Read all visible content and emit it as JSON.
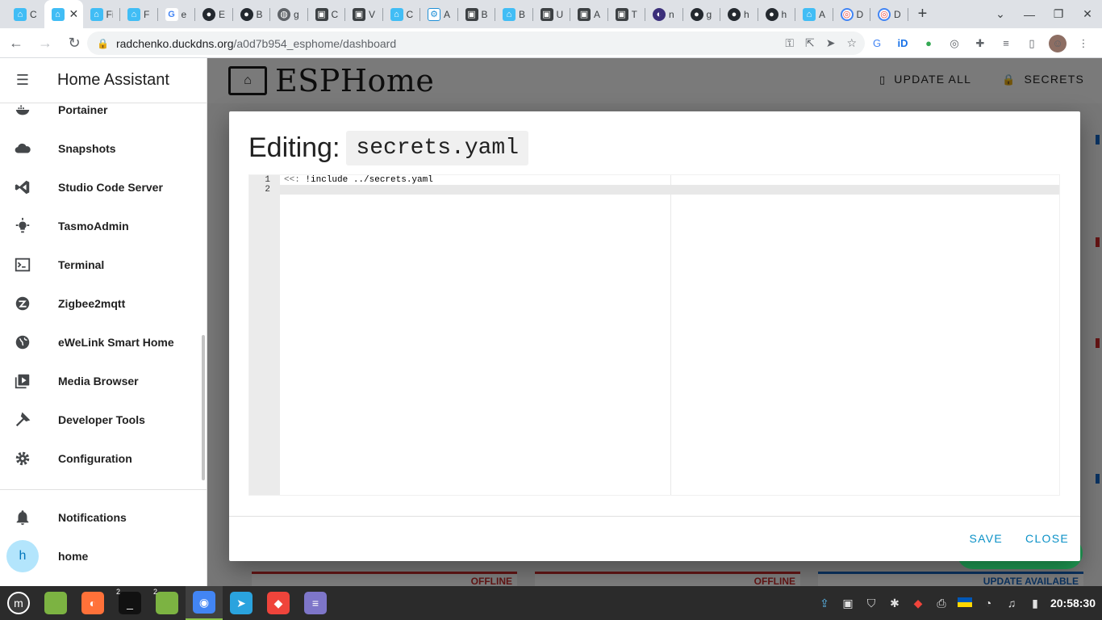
{
  "browser": {
    "tabs": [
      {
        "icon": "ha",
        "label": "C"
      },
      {
        "icon": "ha",
        "label": "",
        "active": true
      },
      {
        "icon": "ha",
        "label": "Fi"
      },
      {
        "icon": "ha",
        "label": "Fi"
      },
      {
        "icon": "g",
        "label": "e"
      },
      {
        "icon": "gh",
        "label": "E"
      },
      {
        "icon": "gh",
        "label": "B"
      },
      {
        "icon": "gl",
        "label": "g"
      },
      {
        "icon": "ro",
        "label": "C"
      },
      {
        "icon": "ro",
        "label": "V"
      },
      {
        "icon": "ha",
        "label": "C"
      },
      {
        "icon": "esp",
        "label": "A"
      },
      {
        "icon": "ro",
        "label": "B"
      },
      {
        "icon": "ha",
        "label": "B"
      },
      {
        "icon": "ro",
        "label": "U"
      },
      {
        "icon": "ro",
        "label": "A"
      },
      {
        "icon": "ro",
        "label": "T"
      },
      {
        "icon": "nr",
        "label": "n"
      },
      {
        "icon": "gh",
        "label": "g"
      },
      {
        "icon": "gh",
        "label": "h"
      },
      {
        "icon": "gh",
        "label": "h"
      },
      {
        "icon": "ha",
        "label": "A"
      },
      {
        "icon": "ch",
        "label": "D"
      },
      {
        "icon": "ch",
        "label": "D"
      }
    ],
    "new_tab": "+",
    "url_host": "radchenko.duckdns.org",
    "url_path": "/a0d7b954_esphome/dashboard"
  },
  "sidebar": {
    "title": "Home Assistant",
    "items": [
      {
        "icon": "docker-icon",
        "label": "Portainer"
      },
      {
        "icon": "cloud-icon",
        "label": "Snapshots"
      },
      {
        "icon": "vscode-icon",
        "label": "Studio Code Server"
      },
      {
        "icon": "bulb-icon",
        "label": "TasmoAdmin"
      },
      {
        "icon": "terminal-icon",
        "label": "Terminal"
      },
      {
        "icon": "zigbee-icon",
        "label": "Zigbee2mqtt"
      },
      {
        "icon": "globe-icon",
        "label": "eWeLink Smart Home"
      },
      {
        "icon": "media-icon",
        "label": "Media Browser"
      },
      {
        "icon": "hammer-icon",
        "label": "Developer Tools"
      },
      {
        "icon": "gear-icon",
        "label": "Configuration"
      }
    ],
    "notifications": "Notifications",
    "user_initial": "h",
    "user_name": "home"
  },
  "esphome": {
    "logo_text": "ESPHome",
    "update_all": "UPDATE ALL",
    "secrets": "SECRETS",
    "cards": [
      {
        "status": "OFFLINE"
      },
      {
        "status": "OFFLINE"
      },
      {
        "status": "UPDATE AVAILABLE"
      }
    ]
  },
  "modal": {
    "title_prefix": "Editing:",
    "filename": "secrets.yaml",
    "line_numbers": [
      "1",
      "2"
    ],
    "lines": [
      "<<: !include ../secrets.yaml",
      ""
    ],
    "save": "SAVE",
    "close": "CLOSE"
  },
  "taskbar": {
    "apps": [
      {
        "icon": "mint-menu-icon",
        "color": "#3c3c3c",
        "glyph": "m"
      },
      {
        "icon": "folder-icon",
        "color": "#7cb342",
        "glyph": ""
      },
      {
        "icon": "firefox-icon",
        "color": "#ff7139",
        "glyph": "◐"
      },
      {
        "icon": "terminal-icon",
        "color": "#111111",
        "glyph": "_",
        "badge": "2"
      },
      {
        "icon": "folder-icon",
        "color": "#7cb342",
        "glyph": "",
        "badge": "2"
      },
      {
        "icon": "chrome-icon",
        "color": "#4285f4",
        "glyph": "◉",
        "active": true
      },
      {
        "icon": "telegram-icon",
        "color": "#2aa3de",
        "glyph": "➤"
      },
      {
        "icon": "anydesk-icon",
        "color": "#ef443b",
        "glyph": "◆"
      },
      {
        "icon": "text-editor-icon",
        "color": "#7e76c9",
        "glyph": "≡"
      }
    ],
    "clock": "20:58:30"
  }
}
